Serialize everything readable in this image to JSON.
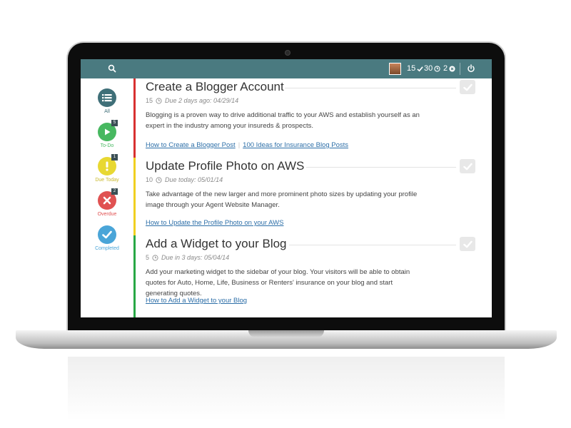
{
  "topbar": {
    "stats": {
      "completed_count": "15",
      "pending_count": "30",
      "overdue_count": "2"
    }
  },
  "sidebar": {
    "items": [
      {
        "label": "All",
        "icon": "list-icon",
        "color": "#3f6f78",
        "badge": ""
      },
      {
        "label": "To-Do",
        "icon": "play-icon",
        "color": "#47b860",
        "badge": "5"
      },
      {
        "label": "Due Today",
        "icon": "exclamation-icon",
        "color": "#e8d832",
        "badge": "1"
      },
      {
        "label": "Overdue",
        "icon": "close-icon",
        "color": "#e05252",
        "badge": "2"
      },
      {
        "label": "Completed",
        "icon": "checkmark-icon",
        "color": "#4aa5d8",
        "badge": ""
      }
    ]
  },
  "tasks": [
    {
      "title": "Create a Blogger Account",
      "minutes": "15",
      "due": "Due 2 days ago: 04/29/14",
      "description": "Blogging is a proven way to drive additional traffic to your AWS and establish yourself as an expert in the industry among your insureds & prospects.",
      "links": [
        "How to Create a Blogger Post",
        "100 Ideas for Insurance Blog Posts"
      ],
      "status_color": "#d83030"
    },
    {
      "title": "Update Profile Photo on AWS",
      "minutes": "10",
      "due": "Due today: 05/01/14",
      "description": "Take advantage of the new larger and more prominent photo sizes by updating your profile image through your Agent Website Manager.",
      "links": [
        "How to Update the Profile Photo on your AWS"
      ],
      "status_color": "#f0d020"
    },
    {
      "title": "Add a Widget to your Blog",
      "minutes": "5",
      "due": "Due in 3 days: 05/04/14",
      "description": "Add your marketing widget to the sidebar of your blog. Your visitors will be able to obtain quotes for Auto, Home, Life, Business or Renters' insurance on your blog and start generating quotes.",
      "links": [
        "How to Add a Widget to your Blog"
      ],
      "status_color": "#28a845"
    }
  ]
}
